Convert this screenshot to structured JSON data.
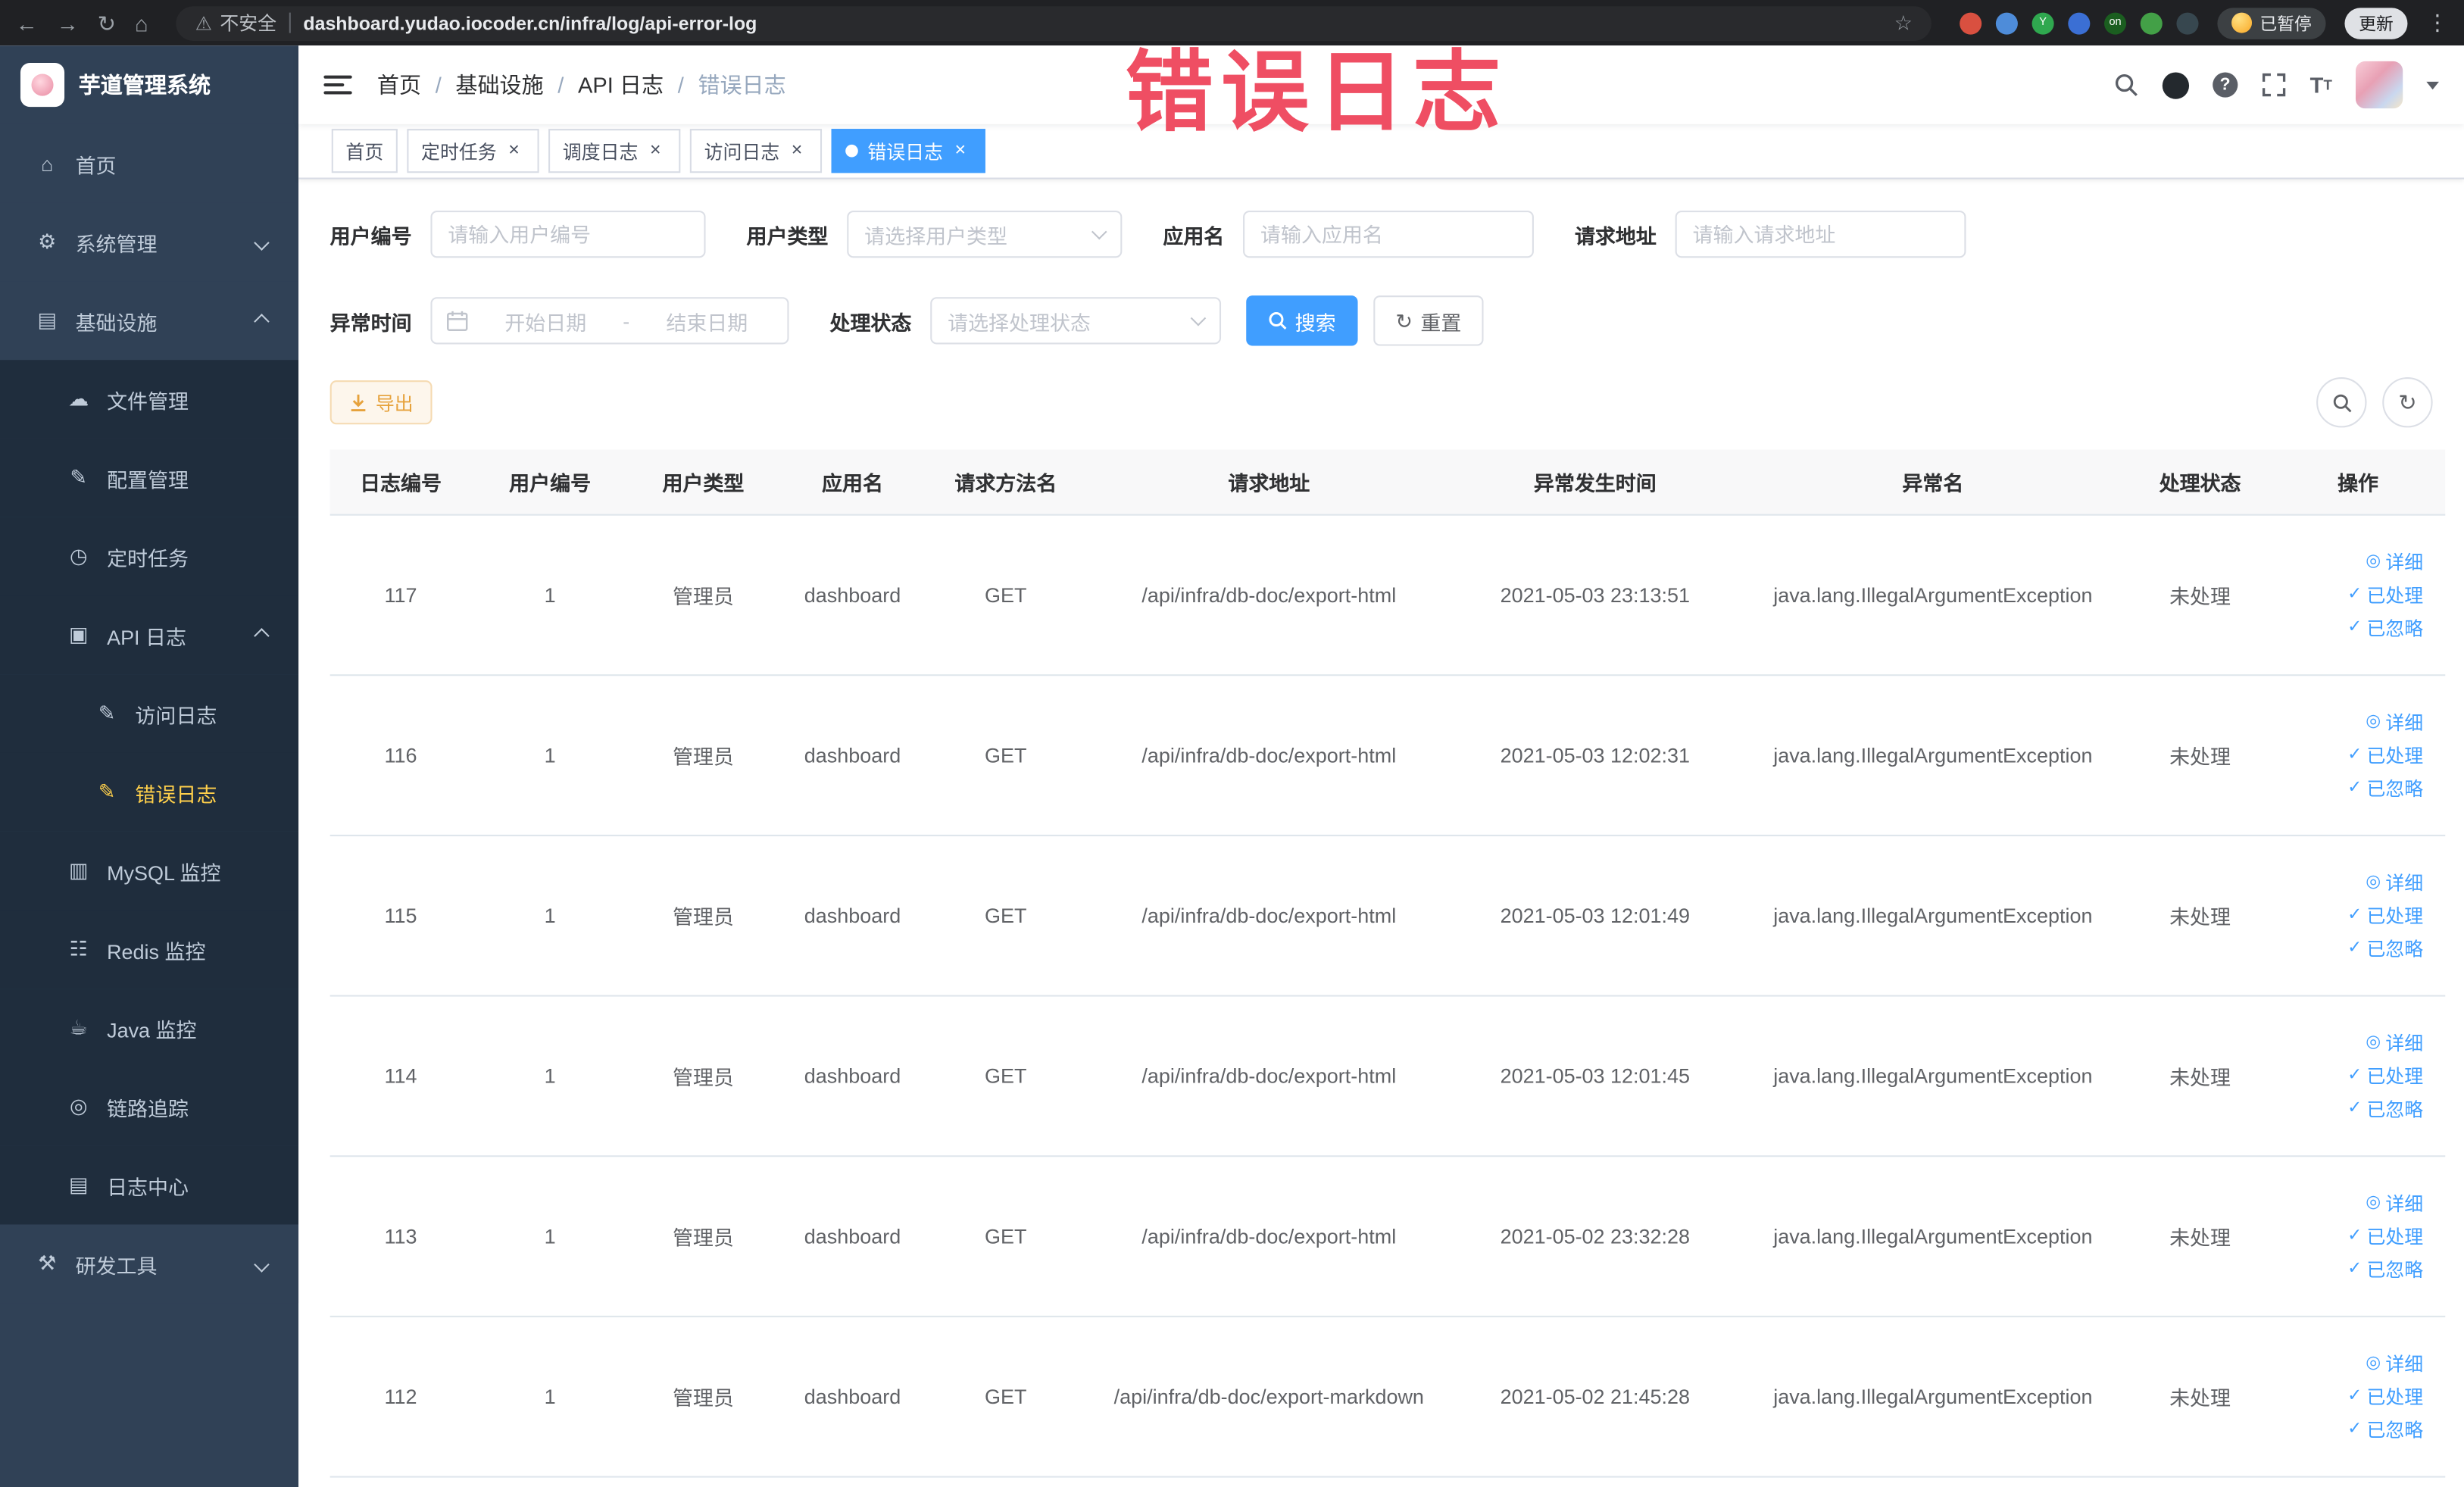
{
  "browser": {
    "security_label": "不安全",
    "url": "dashboard.yudao.iocoder.cn/infra/log/api-error-log",
    "paused_label": "已暂停",
    "update_label": "更新",
    "extensions": [
      {
        "name": "extension-red",
        "color": "#d95040",
        "glyph": ""
      },
      {
        "name": "extension-blue-drop",
        "color": "#4e8cd9",
        "glyph": ""
      },
      {
        "name": "extension-green-y",
        "color": "#2fa84f",
        "glyph": "Y"
      },
      {
        "name": "extension-blue-grid",
        "color": "#3b6fd4",
        "glyph": ""
      },
      {
        "name": "extension-dark-on",
        "color": "#1b5e20",
        "glyph": "on"
      },
      {
        "name": "extension-green-leaf",
        "color": "#43a047",
        "glyph": ""
      },
      {
        "name": "extension-dark-paw",
        "color": "#37474f",
        "glyph": ""
      }
    ]
  },
  "annotation": {
    "text": "错误日志"
  },
  "sidebar": {
    "logo_title": "芋道管理系统",
    "items": [
      {
        "key": "home",
        "icon": "home",
        "label": "首页",
        "level": 1
      },
      {
        "key": "system",
        "icon": "gear",
        "label": "系统管理",
        "level": 1,
        "arrow": "down"
      },
      {
        "key": "infra",
        "icon": "grid",
        "label": "基础设施",
        "level": 1,
        "arrow": "up"
      },
      {
        "key": "file",
        "icon": "cloud",
        "label": "文件管理",
        "level": 2
      },
      {
        "key": "config",
        "icon": "edit",
        "label": "配置管理",
        "level": 2
      },
      {
        "key": "job",
        "icon": "clock",
        "label": "定时任务",
        "level": 2
      },
      {
        "key": "api-log",
        "icon": "doc",
        "label": "API 日志",
        "level": 2,
        "arrow": "up"
      },
      {
        "key": "access-log",
        "icon": "edit-square",
        "label": "访问日志",
        "level": 3
      },
      {
        "key": "error-log",
        "icon": "edit-square",
        "label": "错误日志",
        "level": 3,
        "active": true
      },
      {
        "key": "mysql",
        "icon": "db",
        "label": "MySQL 监控",
        "level": 2
      },
      {
        "key": "redis",
        "icon": "layers",
        "label": "Redis 监控",
        "level": 2
      },
      {
        "key": "java",
        "icon": "coffee",
        "label": "Java 监控",
        "level": 2
      },
      {
        "key": "trace",
        "icon": "eye",
        "label": "链路追踪",
        "level": 2
      },
      {
        "key": "log-center",
        "icon": "log",
        "label": "日志中心",
        "level": 2
      },
      {
        "key": "dev-tools",
        "icon": "tools",
        "label": "研发工具",
        "level": 1,
        "arrow": "down"
      }
    ]
  },
  "header": {
    "breadcrumb": [
      "首页",
      "基础设施",
      "API 日志",
      "错误日志"
    ]
  },
  "tabs": [
    {
      "label": "首页",
      "closable": false,
      "active": false
    },
    {
      "label": "定时任务",
      "closable": true,
      "active": false
    },
    {
      "label": "调度日志",
      "closable": true,
      "active": false
    },
    {
      "label": "访问日志",
      "closable": true,
      "active": false
    },
    {
      "label": "错误日志",
      "closable": true,
      "active": true
    }
  ],
  "filters": {
    "user_id": {
      "label": "用户编号",
      "placeholder": "请输入用户编号"
    },
    "user_type": {
      "label": "用户类型",
      "placeholder": "请选择用户类型"
    },
    "app_name": {
      "label": "应用名",
      "placeholder": "请输入应用名"
    },
    "request_url": {
      "label": "请求地址",
      "placeholder": "请输入请求地址"
    },
    "exception_time": {
      "label": "异常时间",
      "start_placeholder": "开始日期",
      "separator": "-",
      "end_placeholder": "结束日期"
    },
    "process_status": {
      "label": "处理状态",
      "placeholder": "请选择处理状态"
    },
    "search_label": "搜索",
    "reset_label": "重置"
  },
  "toolbar": {
    "export_label": "导出"
  },
  "table": {
    "columns": [
      "日志编号",
      "用户编号",
      "用户类型",
      "应用名",
      "请求方法名",
      "请求地址",
      "异常发生时间",
      "异常名",
      "处理状态",
      "操作"
    ],
    "rows": [
      {
        "id": "117",
        "user_id": "1",
        "user_type": "管理员",
        "app": "dashboard",
        "method": "GET",
        "url": "/api/infra/db-doc/export-html",
        "time": "2021-05-03 23:13:51",
        "exception": "java.lang.IllegalArgumentException",
        "status": "未处理"
      },
      {
        "id": "116",
        "user_id": "1",
        "user_type": "管理员",
        "app": "dashboard",
        "method": "GET",
        "url": "/api/infra/db-doc/export-html",
        "time": "2021-05-03 12:02:31",
        "exception": "java.lang.IllegalArgumentException",
        "status": "未处理"
      },
      {
        "id": "115",
        "user_id": "1",
        "user_type": "管理员",
        "app": "dashboard",
        "method": "GET",
        "url": "/api/infra/db-doc/export-html",
        "time": "2021-05-03 12:01:49",
        "exception": "java.lang.IllegalArgumentException",
        "status": "未处理"
      },
      {
        "id": "114",
        "user_id": "1",
        "user_type": "管理员",
        "app": "dashboard",
        "method": "GET",
        "url": "/api/infra/db-doc/export-html",
        "time": "2021-05-03 12:01:45",
        "exception": "java.lang.IllegalArgumentException",
        "status": "未处理"
      },
      {
        "id": "113",
        "user_id": "1",
        "user_type": "管理员",
        "app": "dashboard",
        "method": "GET",
        "url": "/api/infra/db-doc/export-html",
        "time": "2021-05-02 23:32:28",
        "exception": "java.lang.IllegalArgumentException",
        "status": "未处理"
      },
      {
        "id": "112",
        "user_id": "1",
        "user_type": "管理员",
        "app": "dashboard",
        "method": "GET",
        "url": "/api/infra/db-doc/export-markdown",
        "time": "2021-05-02 21:45:28",
        "exception": "java.lang.IllegalArgumentException",
        "status": "未处理"
      }
    ],
    "actions": [
      {
        "key": "detail",
        "label": "详细",
        "icon": "eye"
      },
      {
        "key": "processed",
        "label": "已处理",
        "icon": "check"
      },
      {
        "key": "ignored",
        "label": "已忽略",
        "icon": "check"
      }
    ]
  },
  "colors": {
    "accent": "#409eff",
    "sidebar_bg": "#304156",
    "submenu_bg": "#1f2d3d",
    "active_menu_text": "#ffd04b",
    "annotation": "#ee4056",
    "warning_button": "#e6a23c"
  }
}
